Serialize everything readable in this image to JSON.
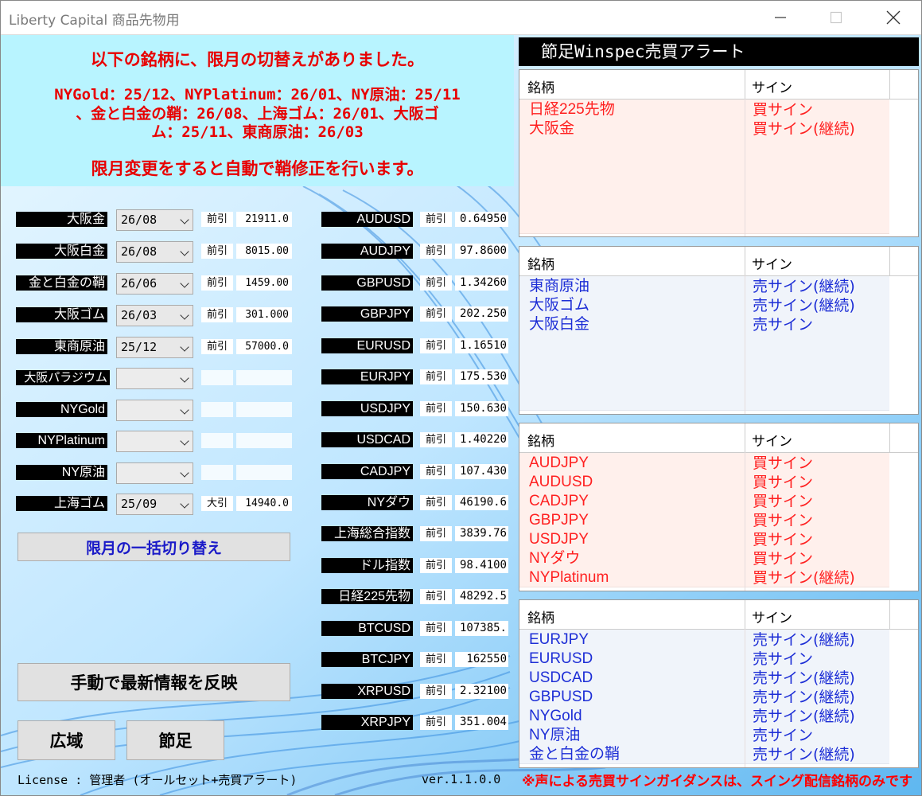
{
  "window": {
    "title": "Liberty Capital 商品先物用",
    "minimize_icon": "minimize-icon",
    "maximize_icon": "maximize-icon",
    "close_icon": "close-icon"
  },
  "banner": {
    "line1": "以下の銘柄に、限月の切替えがありました。",
    "line2": "NYGold：25/12、NYPlatinum：26/01、NY原油：25/11",
    "line3": "、金と白金の鞘：26/08、上海ゴム：26/01、大阪ゴ",
    "line4": "ム：25/11、東商原油：26/03",
    "line5": "限月変更をすると自動で鞘修正を行います。"
  },
  "commodities": [
    {
      "label": "大阪金",
      "month": "26/08",
      "key": "前引",
      "value": "21911.0"
    },
    {
      "label": "大阪白金",
      "month": "26/08",
      "key": "前引",
      "value": "8015.00"
    },
    {
      "label": "金と白金の鞘",
      "month": "26/06",
      "key": "前引",
      "value": "1459.00"
    },
    {
      "label": "大阪ゴム",
      "month": "26/03",
      "key": "前引",
      "value": "301.000"
    },
    {
      "label": "東商原油",
      "month": "25/12",
      "key": "前引",
      "value": "57000.0"
    },
    {
      "label": "大阪パラジウム",
      "month": "",
      "key": "",
      "value": ""
    },
    {
      "label": "NYGold",
      "month": "",
      "key": "",
      "value": ""
    },
    {
      "label": "NYPlatinum",
      "month": "",
      "key": "",
      "value": ""
    },
    {
      "label": "NY原油",
      "month": "",
      "key": "",
      "value": ""
    },
    {
      "label": "上海ゴム",
      "month": "25/09",
      "key": "大引",
      "value": "14940.0"
    }
  ],
  "fx": [
    {
      "label": "AUDUSD",
      "key": "前引",
      "value": "0.64950"
    },
    {
      "label": "AUDJPY",
      "key": "前引",
      "value": "97.8600"
    },
    {
      "label": "GBPUSD",
      "key": "前引",
      "value": "1.34260"
    },
    {
      "label": "GBPJPY",
      "key": "前引",
      "value": "202.250"
    },
    {
      "label": "EURUSD",
      "key": "前引",
      "value": "1.16510"
    },
    {
      "label": "EURJPY",
      "key": "前引",
      "value": "175.530"
    },
    {
      "label": "USDJPY",
      "key": "前引",
      "value": "150.630"
    },
    {
      "label": "USDCAD",
      "key": "前引",
      "value": "1.40220"
    },
    {
      "label": "CADJPY",
      "key": "前引",
      "value": "107.430"
    },
    {
      "label": "NYダウ",
      "key": "前引",
      "value": "46190.6"
    },
    {
      "label": "上海総合指数",
      "key": "前引",
      "value": "3839.76"
    },
    {
      "label": "ドル指数",
      "key": "前引",
      "value": "98.4100"
    },
    {
      "label": "日経225先物",
      "key": "前引",
      "value": "48292.5"
    },
    {
      "label": "BTCUSD",
      "key": "前引",
      "value": "107385."
    },
    {
      "label": "BTCJPY",
      "key": "前引",
      "value": "162550"
    },
    {
      "label": "XRPUSD",
      "key": "前引",
      "value": "2.32100"
    },
    {
      "label": "XRPJPY",
      "key": "前引",
      "value": "351.004"
    }
  ],
  "buttons": {
    "bulk_switch": "限月の一括切り替え",
    "manual_refresh": "手動で最新情報を反映",
    "wide": "広域",
    "daily": "節足"
  },
  "alert": {
    "header": "節足Winspec売買アラート",
    "col_name": "銘柄",
    "col_sign": "サイン",
    "panels": [
      {
        "tone": "buy",
        "rows": [
          {
            "name": "日経225先物",
            "sign": "買サイン"
          },
          {
            "name": "大阪金",
            "sign": "買サイン(継続)"
          }
        ]
      },
      {
        "tone": "sell",
        "rows": [
          {
            "name": "東商原油",
            "sign": "売サイン(継続)"
          },
          {
            "name": "大阪ゴム",
            "sign": "売サイン(継続)"
          },
          {
            "name": "大阪白金",
            "sign": "売サイン"
          }
        ]
      },
      {
        "tone": "buy",
        "rows": [
          {
            "name": "AUDJPY",
            "sign": "買サイン"
          },
          {
            "name": "AUDUSD",
            "sign": "買サイン"
          },
          {
            "name": "CADJPY",
            "sign": "買サイン"
          },
          {
            "name": "GBPJPY",
            "sign": "買サイン"
          },
          {
            "name": "USDJPY",
            "sign": "買サイン"
          },
          {
            "name": "NYダウ",
            "sign": "買サイン"
          },
          {
            "name": "NYPlatinum",
            "sign": "買サイン(継続)"
          }
        ]
      },
      {
        "tone": "sell",
        "rows": [
          {
            "name": "EURJPY",
            "sign": "売サイン(継続)"
          },
          {
            "name": "EURUSD",
            "sign": "売サイン"
          },
          {
            "name": "USDCAD",
            "sign": "売サイン(継続)"
          },
          {
            "name": "GBPUSD",
            "sign": "売サイン(継続)"
          },
          {
            "name": "NYGold",
            "sign": "売サイン(継続)"
          },
          {
            "name": "NY原油",
            "sign": "売サイン"
          },
          {
            "name": "金と白金の鞘",
            "sign": "売サイン(継続)"
          }
        ]
      }
    ]
  },
  "footer": {
    "license": "License : 管理者 (オールセット+売買アラート)",
    "version": "ver.1.1.0.0",
    "notice": "※声による売買サインガイダンスは、スイング配信銘柄のみです"
  },
  "colors": {
    "buy": "#ff2020",
    "sell": "#1d2ed6",
    "banner_text": "#e80000",
    "banner_bg": "#b8f4ff"
  }
}
